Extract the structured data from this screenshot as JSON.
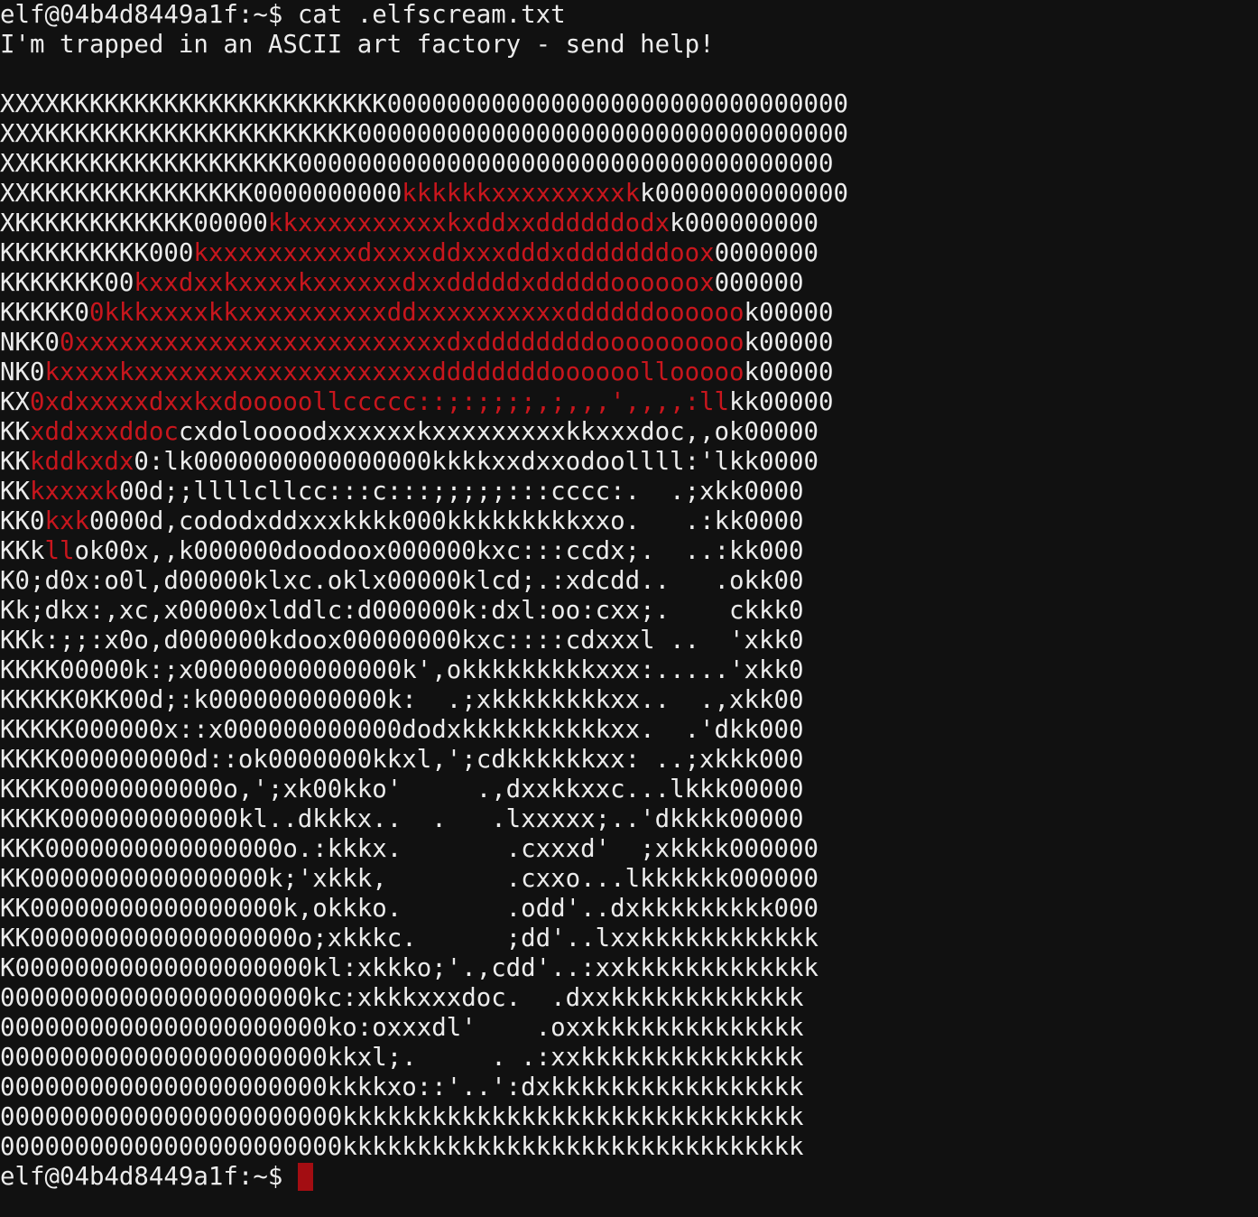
{
  "terminal": {
    "prompt": "elf@04b4d8449a1f:~$ ",
    "command": "cat .elfscream.txt",
    "message": "I'm trapped in an ASCII art factory - send help!",
    "colors": {
      "background": "#111111",
      "text": "#ececec",
      "highlight": "#c8161d",
      "cursor": "#a30d12"
    },
    "art_lines": [
      {
        "a": "XXXXKKKKKKKKKKKKKKKKKKKKKK0000000000000000000000000000000",
        "r": "",
        "b": ""
      },
      {
        "a": "XXXKKKKKKKKKKKKKKKKKKKKK000000000000000000000000000000000",
        "r": "",
        "b": ""
      },
      {
        "a": "XXKKKKKKKKKKKKKKKKKK000000000000000000000000000000000000",
        "r": "",
        "b": ""
      },
      {
        "a": "XXKKKKKKKKKKKKKKK0000000000",
        "r": "kkkkkkxxxxxxxxxk",
        "b": "k0000000000000"
      },
      {
        "a": "XKKKKKKKKKKKK00000",
        "r": "kkxxxxxxxxxxkxddxxddddddodx",
        "b": "k000000000"
      },
      {
        "a": "KKKKKKKKKK000",
        "r": "kxxxxxxxxxxdxxxxddxxxdddxdddddddoox",
        "b": "0000000"
      },
      {
        "a": "KKKKKKK00",
        "r": "kxxdxxkxxxxkxxxxxxdxxdddddxdddddoooooox",
        "b": "000000"
      },
      {
        "a": "KKKKK0",
        "r": "0kkkxxxxkkxxxxxxxxxxddxxxxxxxxxxddddddoooooo",
        "b": "k00000"
      },
      {
        "a": "NKK0",
        "r": "0xxxxxxxxxxxxxxxxxxxxxxxxxdxddddddddoooooooooo",
        "b": "k00000"
      },
      {
        "a": "NK0",
        "r": "kxxxxkxxxxxxxxxxxxxxxxxxxxddddddddoooooollooooo",
        "b": "k00000"
      },
      {
        "a": "KX",
        "r": "0xdxxxxxdxxkxdooooollccccc::;:;;;;,;,,,',,,,:ll",
        "b": "kk00000"
      },
      {
        "a": "KK",
        "r": "xddxxxddoc",
        "b": "cxdoloooodxxxxxxkxxxxxxxxxkkxxxdoc,,ok00000"
      },
      {
        "a": "KK",
        "r": "kddkxdx",
        "b": "0:lk0000000000000000kkkkxxdxxodoollll:'lkk0000"
      },
      {
        "a": "KK",
        "r": "kxxxxk",
        "b": "00d;;llllcllcc:::c:::;;;;;:::cccc:.  .;xkk0000"
      },
      {
        "a": "KK0",
        "r": "kxk",
        "b": "0000d,cododxddxxxkkkk000kkkkkkkkkxxo.   .:kk0000"
      },
      {
        "a": "KKk",
        "r": "ll",
        "b": "ok00x,,k000000doodoox000000kxc:::ccdx;.  ..:kk000"
      },
      {
        "a": "K0;d0x:o0l,d00000klxc.oklx00000klcd;.:xdcdd..   .okk00",
        "r": "",
        "b": ""
      },
      {
        "a": "Kk;dkx:,xc,x00000xlddlc:d000000k:dxl:oo:cxx;.    ckkk0",
        "r": "",
        "b": ""
      },
      {
        "a": "KKk:;;:x0o,d000000kdoox00000000kxc::::cdxxxl ..  'xkk0",
        "r": "",
        "b": ""
      },
      {
        "a": "KKKK00000k:;x00000000000000k',okkkkkkkkkxxx:.....'xkk0",
        "r": "",
        "b": ""
      },
      {
        "a": "KKKKK0KK00d;:k000000000000k:  .;xkkkkkkkkxx..  .,xkk00",
        "r": "",
        "b": ""
      },
      {
        "a": "KKKKK000000x::x000000000000dodxkkkkkkkkkkxx.  .'dkk000",
        "r": "",
        "b": ""
      },
      {
        "a": "KKKK000000000d::ok0000000kkxl,';cdkkkkkkxx: ..;xkkk000",
        "r": "",
        "b": ""
      },
      {
        "a": "KKKK00000000000o,';xk00kko'     .,dxxkkxxc...lkkk00000",
        "r": "",
        "b": ""
      },
      {
        "a": "KKKK000000000000kl..dkkkx..  .   .lxxxxx;..'dkkkk00000",
        "r": "",
        "b": ""
      },
      {
        "a": "KKK0000000000000000o.:kkkx.       .cxxxd'  ;xkkkk000000",
        "r": "",
        "b": ""
      },
      {
        "a": "KK0000000000000000k;'xkkk,        .cxxo...lkkkkkk000000",
        "r": "",
        "b": ""
      },
      {
        "a": "KK00000000000000000k,okkko.       .odd'..dxkkkkkkkkk000",
        "r": "",
        "b": ""
      },
      {
        "a": "KK000000000000000000o;xkkkc.      ;dd'..lxxkkkkkkkkkkkk",
        "r": "",
        "b": ""
      },
      {
        "a": "K00000000000000000000kl:xkkko;'.,cdd'..:xxkkkkkkkkkkkkk",
        "r": "",
        "b": ""
      },
      {
        "a": "000000000000000000000kc:xkkkxxxdoc.  .dxxkkkkkkkkkkkkk",
        "r": "",
        "b": ""
      },
      {
        "a": "0000000000000000000000ko:oxxxdl'    .oxxkkkkkkkkkkkkkk",
        "r": "",
        "b": ""
      },
      {
        "a": "0000000000000000000000kkxl;.     . .:xxkkkkkkkkkkkkkkk",
        "r": "",
        "b": ""
      },
      {
        "a": "0000000000000000000000kkkkxo::'..':dxkkkkkkkkkkkkkkkkk",
        "r": "",
        "b": ""
      },
      {
        "a": "00000000000000000000000kkkkkkkkkkkkkkkkkkkkkkkkkkkkkkk",
        "r": "",
        "b": ""
      },
      {
        "a": "00000000000000000000000kkkkkkkkkkkkkkkkkkkkkkkkkkkkkkk",
        "r": "",
        "b": ""
      }
    ]
  }
}
